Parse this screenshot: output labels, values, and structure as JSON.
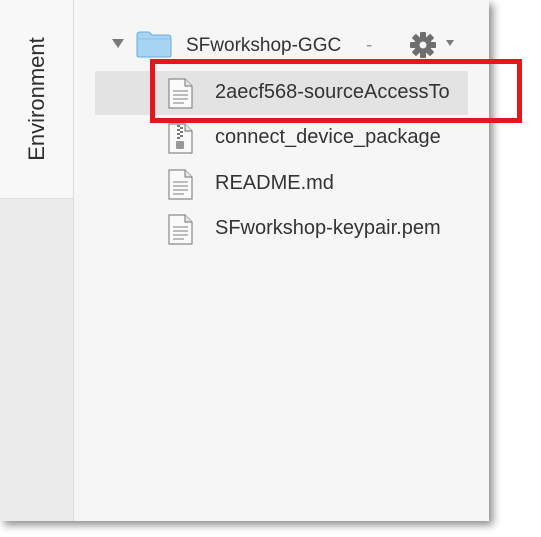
{
  "sidebar": {
    "environment_tab": "Environment"
  },
  "tree": {
    "root": {
      "label": "SFworkshop-GGC",
      "suffix": "-"
    },
    "files": [
      {
        "label": "2aecf568-sourceAccessTo",
        "icon": "text-file-icon",
        "selected": true
      },
      {
        "label": "connect_device_package",
        "icon": "zip-file-icon",
        "selected": false
      },
      {
        "label": "README.md",
        "icon": "text-file-icon",
        "selected": false
      },
      {
        "label": "SFworkshop-keypair.pem",
        "icon": "text-file-icon",
        "selected": false
      }
    ]
  },
  "colors": {
    "highlight": "#e6161b",
    "folder": "#a8d4f3",
    "selection": "#e3e3e3"
  }
}
